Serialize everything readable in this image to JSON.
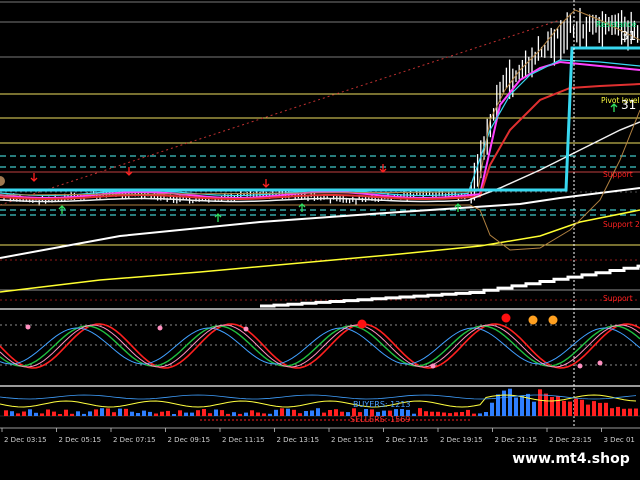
{
  "chart_data": {
    "type": "line",
    "panels": [
      "price",
      "stochastic",
      "buyers_sellers_histogram"
    ],
    "x_ticks": [
      "2 Dec 03:15",
      "2 Dec 05:15",
      "2 Dec 07:15",
      "2 Dec 09:15",
      "2 Dec 11:15",
      "2 Dec 13:15",
      "2 Dec 15:15",
      "2 Dec 17:15",
      "2 Dec 19:15",
      "2 Dec 21:15",
      "2 Dec 23:15",
      "3 Dec 01"
    ],
    "level_labels": {
      "resistance": "Resistance",
      "pivot": "Pivot level",
      "support_1": "Support",
      "support_2": "Support 2",
      "support_3": "Support"
    },
    "price_readout_top": "31",
    "price_readout_mid": "31",
    "buyers_label": "BUYERS: 1213",
    "sellers_label": "SELLERS: 1569",
    "colors": {
      "background": "#000000",
      "resistance": "#00e676",
      "support": "#ff2020",
      "pivot": "#ffff40",
      "level_line": "#f0e060",
      "dashed_level": "#40c8c8",
      "ma_cyan": "#38d8f0",
      "ma_magenta": "#ff40ff",
      "ma_red": "#e03030",
      "ma_white": "#ffffff",
      "ma_yellow": "#ffff30",
      "envelope": "#b08040",
      "stoch_red": "#ff2020",
      "stoch_green": "#20c040",
      "stoch_blue": "#40a0ff",
      "stoch_pink": "#ff90c0",
      "buyers": "#2f7fff",
      "sellers": "#ff2020"
    },
    "icons": [
      "sell-arrow-icon",
      "buy-arrow-icon",
      "signal-dot-icon"
    ]
  },
  "branding": {
    "watermark": "www.mt4.shop"
  }
}
